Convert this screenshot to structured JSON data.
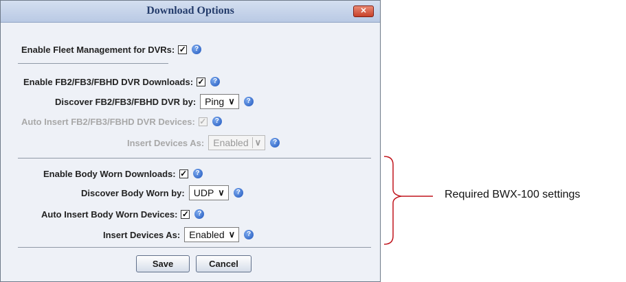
{
  "dialog": {
    "title": "Download Options",
    "close_glyph": "✕"
  },
  "fleet": {
    "enable_label": "Enable Fleet Management for DVRs:",
    "enable_checked": true
  },
  "fb": {
    "enable_label": "Enable FB2/FB3/FBHD DVR Downloads:",
    "enable_checked": true,
    "discover_label": "Discover FB2/FB3/FBHD DVR by:",
    "discover_value": "Ping",
    "auto_insert_label": "Auto Insert FB2/FB3/FBHD DVR Devices:",
    "auto_insert_checked": true,
    "insert_as_label": "Insert Devices As:",
    "insert_as_value": "Enabled"
  },
  "body_worn": {
    "enable_label": "Enable Body Worn Downloads:",
    "enable_checked": true,
    "discover_label": "Discover Body Worn by:",
    "discover_value": "UDP",
    "auto_insert_label": "Auto Insert Body Worn Devices:",
    "auto_insert_checked": true,
    "insert_as_label": "Insert Devices As:",
    "insert_as_value": "Enabled"
  },
  "buttons": {
    "save": "Save",
    "cancel": "Cancel"
  },
  "annotation": {
    "text": "Required BWX-100 settings",
    "color": "#c0141c"
  },
  "icons": {
    "checkbox_check": "✓",
    "help": "?",
    "dropdown_arrow": "∨"
  }
}
